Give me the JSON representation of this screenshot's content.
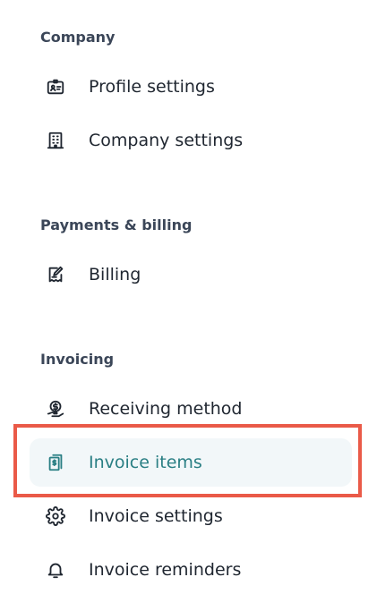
{
  "sections": [
    {
      "heading": "Company",
      "items": [
        {
          "label": "Profile settings",
          "icon": "id-card-icon"
        },
        {
          "label": "Company settings",
          "icon": "building-icon"
        }
      ]
    },
    {
      "heading": "Payments & billing",
      "items": [
        {
          "label": "Billing",
          "icon": "receipt-edit-icon"
        }
      ]
    },
    {
      "heading": "Invoicing",
      "items": [
        {
          "label": "Receiving method",
          "icon": "hand-coin-icon"
        },
        {
          "label": "Invoice items",
          "icon": "invoice-dollar-icon",
          "active": true
        },
        {
          "label": "Invoice settings",
          "icon": "gear-icon"
        },
        {
          "label": "Invoice reminders",
          "icon": "bell-icon"
        }
      ]
    }
  ],
  "colors": {
    "heading": "#3b4658",
    "text": "#1f2630",
    "active_text": "#2a7f84",
    "active_bg": "#f2f7f9",
    "highlight": "#ea5a48"
  }
}
